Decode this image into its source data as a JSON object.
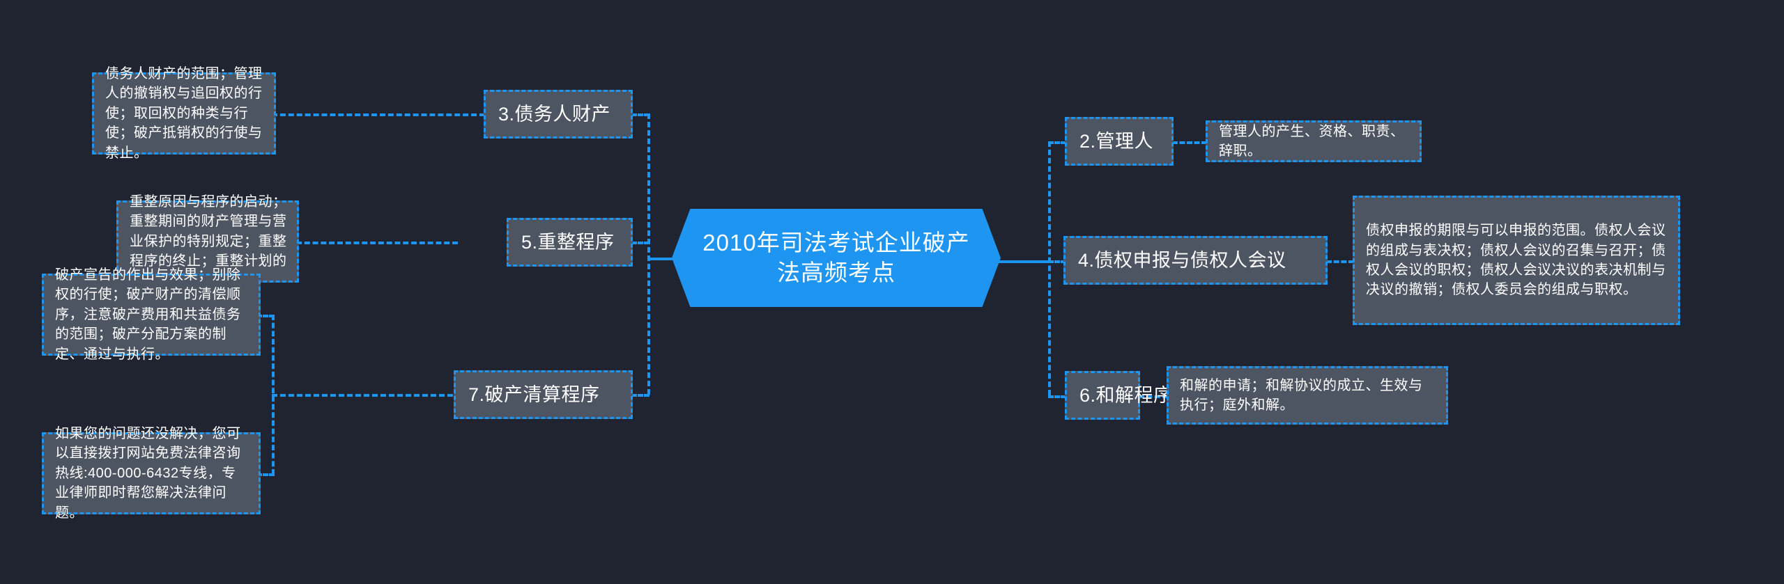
{
  "center": {
    "title": "2010年司法考试企业破产法高频考点",
    "accent_color": "#1e95f0",
    "background_color": "#1f2430",
    "node_fill_color": "#4d5462"
  },
  "left_branches": [
    {
      "topic": "3.债务人财产",
      "detail": "债务人财产的范围；管理人的撤销权与追回权的行使；取回权的种类与行使；破产抵销权的行使与禁止。"
    },
    {
      "topic": "5.重整程序",
      "detail": "重整原因与程序的启动；重整期间的财产管理与营业保护的特别规定；重整程序的终止；重整计划的制定、批准和执行。"
    },
    {
      "topic": "7.破产清算程序",
      "detail": "破产宣告的作出与效果；别除权的行使；破产财产的清偿顺序，注意破产费用和共益债务的范围；破产分配方案的制定、通过与执行。",
      "detail2": "如果您的问题还没解决，您可以直接拨打网站免费法律咨询热线:400-000-6432专线，专业律师即时帮您解决法律问题。"
    }
  ],
  "right_branches": [
    {
      "topic": "2.管理人",
      "detail": "管理人的产生、资格、职责、辞职。"
    },
    {
      "topic": "4.债权申报与债权人会议",
      "detail": "债权申报的期限与可以申报的范围。债权人会议的组成与表决权；债权人会议的召集与召开；债权人会议的职权；债权人会议决议的表决机制与决议的撤销；债权人委员会的组成与职权。"
    },
    {
      "topic": "6.和解程序",
      "detail": "和解的申请；和解协议的成立、生效与执行；庭外和解。"
    }
  ]
}
